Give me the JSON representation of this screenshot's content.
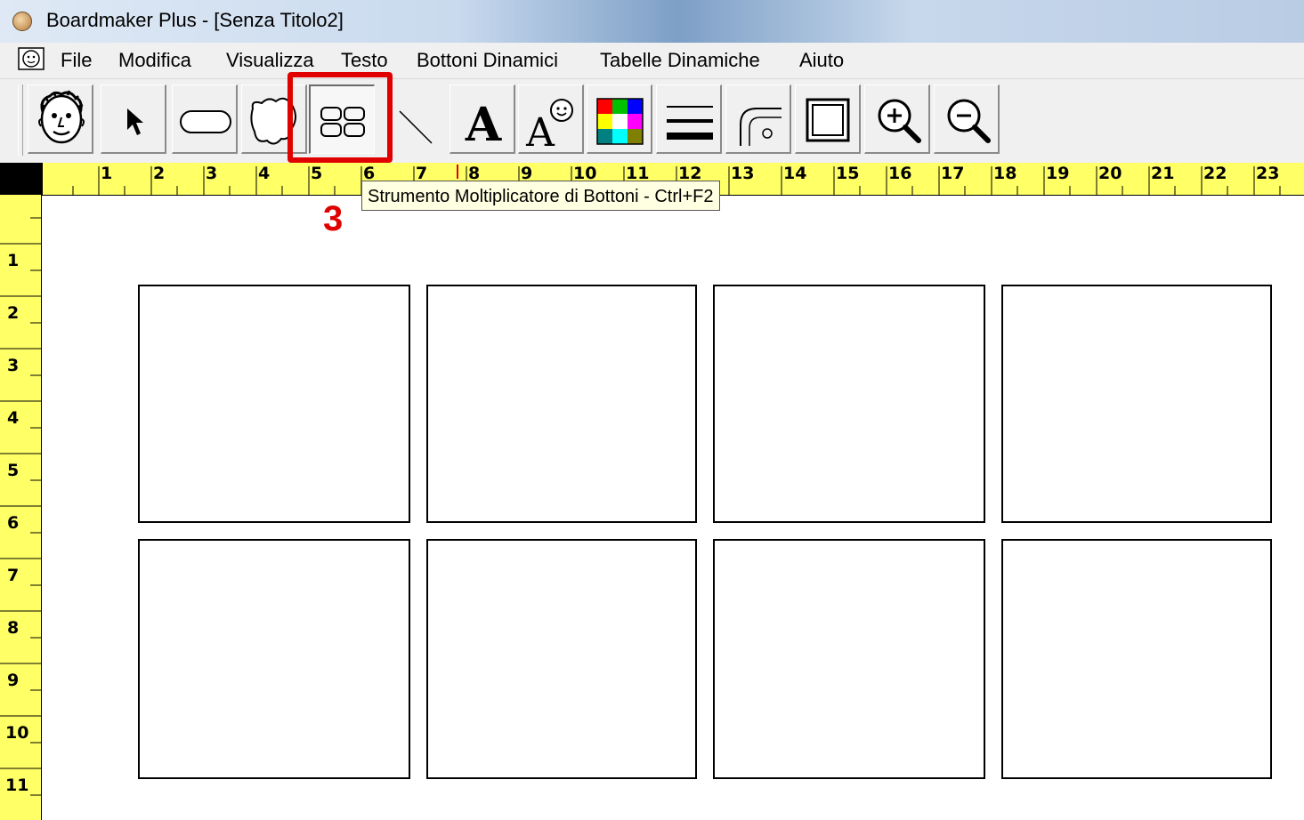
{
  "window": {
    "title": "Boardmaker Plus - [Senza Titolo2]"
  },
  "menu": {
    "items": [
      {
        "id": "file",
        "label": "File"
      },
      {
        "id": "modifica",
        "label": "Modifica"
      },
      {
        "id": "visualizza",
        "label": "Visualizza"
      },
      {
        "id": "testo",
        "label": "Testo"
      },
      {
        "id": "bottoni",
        "label": "Bottoni Dinamici"
      },
      {
        "id": "tabelle",
        "label": "Tabelle Dinamiche"
      },
      {
        "id": "aiuto",
        "label": "Aiuto"
      }
    ]
  },
  "toolbar": {
    "tools": [
      {
        "icon": "symbol-finder-face-icon"
      },
      {
        "icon": "pointer-arrow-icon"
      },
      {
        "icon": "rounded-rectangle-icon"
      },
      {
        "icon": "freeform-shape-icon"
      },
      {
        "icon": "button-sequencer-icon",
        "selected": true
      },
      {
        "icon": "line-icon"
      },
      {
        "icon": "text-icon"
      },
      {
        "icon": "symbol-text-icon"
      },
      {
        "icon": "color-palette-icon"
      },
      {
        "icon": "line-thickness-icon"
      },
      {
        "icon": "corner-radius-icon"
      },
      {
        "icon": "border-frame-icon"
      },
      {
        "icon": "zoom-in-icon"
      },
      {
        "icon": "zoom-out-icon"
      }
    ]
  },
  "tooltip": {
    "text": "Strumento Moltiplicatore di Bottoni - Ctrl+F2"
  },
  "annotation": {
    "step": "3",
    "color": "#e00000"
  },
  "ruler": {
    "top": [
      "1",
      "2",
      "3",
      "4",
      "5",
      "6",
      "7",
      "8",
      "9",
      "10",
      "11",
      "12",
      "13",
      "14",
      "15",
      "16",
      "17",
      "18",
      "19",
      "20",
      "21",
      "22",
      "23"
    ],
    "left": [
      "1",
      "2",
      "3",
      "4",
      "5",
      "6",
      "7",
      "8",
      "9",
      "10",
      "11"
    ],
    "color": "#ffff66"
  },
  "board": {
    "rows": 2,
    "cols": 4
  }
}
